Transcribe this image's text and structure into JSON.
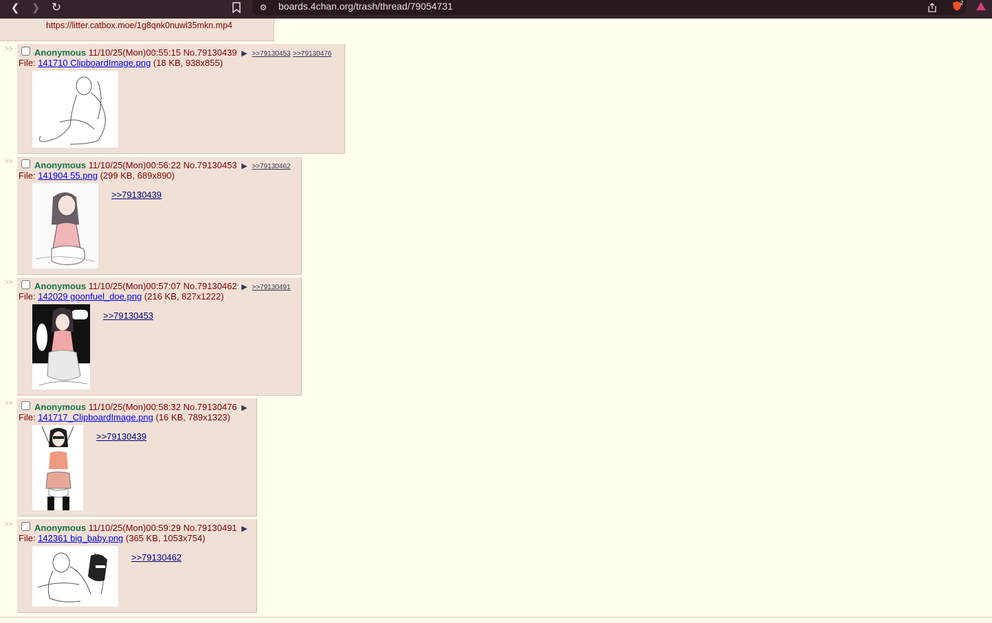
{
  "browser": {
    "url": "boards.4chan.org/trash/thread/79054731",
    "extensions_badge": "2"
  },
  "top_reply": {
    "link": "https://litter.catbox.moe/1g8qnk0nuwl35mkn.mp4"
  },
  "posts": [
    {
      "name": "Anonymous",
      "datetime": "11/10/25(Mon)00:55:15",
      "number": "No.79130439",
      "backlinks": [
        ">>79130453",
        ">>79130476"
      ],
      "file_label": "File:",
      "file_name": "141710 ClipboardImage.png",
      "file_meta": "(18 KB, 938x855)",
      "quote": ""
    },
    {
      "name": "Anonymous",
      "datetime": "11/10/25(Mon)00:56:22",
      "number": "No.79130453",
      "backlinks": [
        ">>79130462"
      ],
      "file_label": "File:",
      "file_name": "141904 55.png",
      "file_meta": "(299 KB, 689x890)",
      "quote": ">>79130439"
    },
    {
      "name": "Anonymous",
      "datetime": "11/10/25(Mon)00:57:07",
      "number": "No.79130462",
      "backlinks": [
        ">>79130491"
      ],
      "file_label": "File:",
      "file_name": "142029 goonfuel_doe.png",
      "file_meta": "(216 KB, 827x1222)",
      "quote": ">>79130453"
    },
    {
      "name": "Anonymous",
      "datetime": "11/10/25(Mon)00:58:32",
      "number": "No.79130476",
      "backlinks": [],
      "file_label": "File:",
      "file_name": "141717_ClipboardImage.png",
      "file_meta": "(16 KB, 789x1323)",
      "quote": ">>79130439"
    },
    {
      "name": "Anonymous",
      "datetime": "11/10/25(Mon)00:59:29",
      "number": "No.79130491",
      "backlinks": [],
      "file_label": "File:",
      "file_name": "142361 big_baby.png",
      "file_meta": "(365 KB, 1053x754)",
      "quote": ">>79130462"
    }
  ],
  "side_marker": ">>"
}
